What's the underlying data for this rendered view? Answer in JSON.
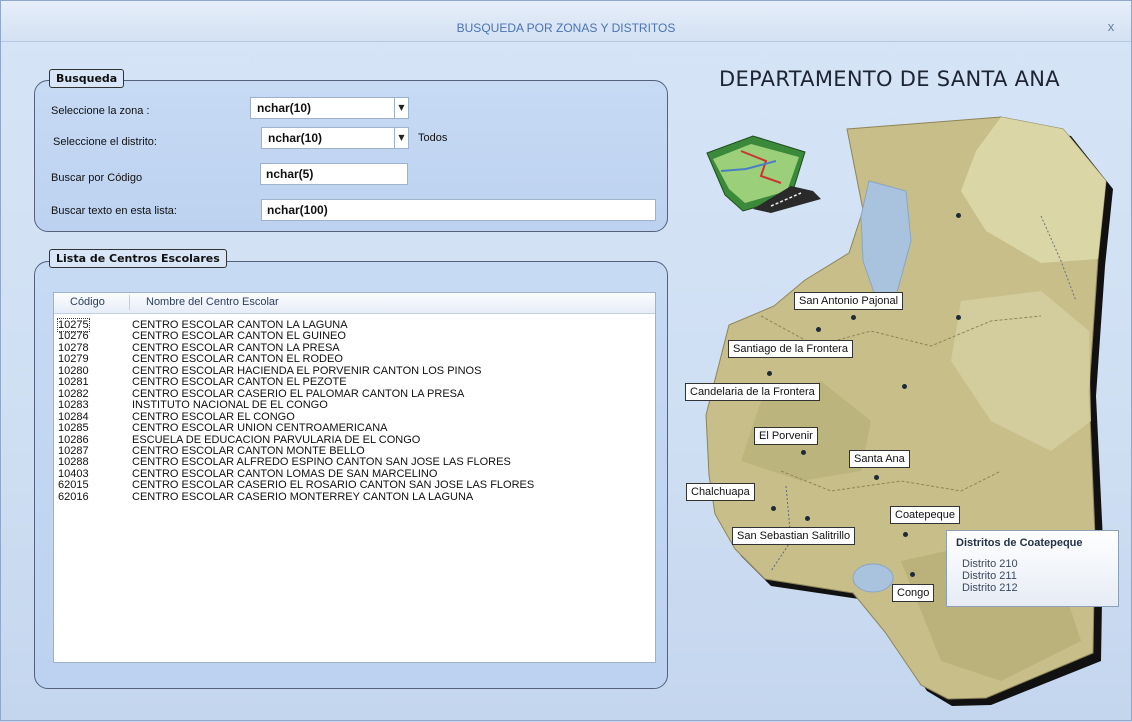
{
  "window": {
    "title": "BUSQUEDA POR ZONAS Y DISTRITOS",
    "close_label": "x"
  },
  "search": {
    "legend": "Busqueda",
    "zona_label": "Seleccione la zona :",
    "zona_value": "nchar(10)",
    "distrito_label": "Seleccione el distrito:",
    "distrito_value": "nchar(10)",
    "distrito_hint": "Todos",
    "codigo_label": "Buscar por Código",
    "codigo_value": "nchar(5)",
    "texto_label": "Buscar texto en esta lista:",
    "texto_value": "nchar(100)"
  },
  "list": {
    "legend": "Lista de Centros Escolares",
    "columns": [
      "Código",
      "Nombre del Centro Escolar"
    ],
    "rows": [
      [
        "10275",
        "CENTRO ESCOLAR CANTON LA LAGUNA"
      ],
      [
        "10276",
        "CENTRO ESCOLAR CANTON EL GUINEO"
      ],
      [
        "10278",
        "CENTRO ESCOLAR CANTON LA PRESA"
      ],
      [
        "10279",
        "CENTRO ESCOLAR CANTON EL RODEO"
      ],
      [
        "10280",
        "CENTRO ESCOLAR HACIENDA EL PORVENIR CANTON LOS PINOS"
      ],
      [
        "10281",
        "CENTRO ESCOLAR CANTON EL PEZOTE"
      ],
      [
        "10282",
        "CENTRO ESCOLAR CASERIO EL PALOMAR CANTON LA PRESA"
      ],
      [
        "10283",
        "INSTITUTO NACIONAL DE EL CONGO"
      ],
      [
        "10284",
        "CENTRO ESCOLAR EL CONGO"
      ],
      [
        "10285",
        "CENTRO ESCOLAR UNION CENTROAMERICANA"
      ],
      [
        "10286",
        "ESCUELA DE EDUCACION PARVULARIA DE EL CONGO"
      ],
      [
        "10287",
        "CENTRO ESCOLAR CANTON MONTE BELLO"
      ],
      [
        "10288",
        "CENTRO ESCOLAR ALFREDO ESPINO CANTON SAN JOSE LAS FLORES"
      ],
      [
        "10403",
        "CENTRO ESCOLAR CANTON LOMAS DE SAN MARCELINO"
      ],
      [
        "62015",
        "CENTRO ESCOLAR CASERIO EL ROSARIO CANTON SAN JOSE LAS FLORES"
      ],
      [
        "62016",
        "CENTRO ESCOLAR CASERIO MONTERREY CANTON LA LAGUNA"
      ]
    ]
  },
  "map": {
    "title": "DEPARTAMENTO DE SANTA ANA",
    "cities": {
      "san_antonio_pajonal": "San Antonio Pajonal",
      "santiago_frontera": "Santiago de la Frontera",
      "candelaria_frontera": "Candelaria de la Frontera",
      "el_porvenir": "El Porvenir",
      "santa_ana": "Santa Ana",
      "chalchuapa": "Chalchuapa",
      "coatepeque": "Coatepeque",
      "san_sebastian_salitrillo": "San Sebastian Salitrillo",
      "congo": "Congo"
    },
    "tooltip": {
      "title": "Distritos de Coatepeque",
      "items": [
        "Distrito 210",
        "Distrito 211",
        "Distrito 212"
      ]
    },
    "colors": {
      "land": "#c7be8a",
      "land_light": "#ddd8a8",
      "water": "#a9c3df",
      "shadow": "#111111"
    }
  }
}
